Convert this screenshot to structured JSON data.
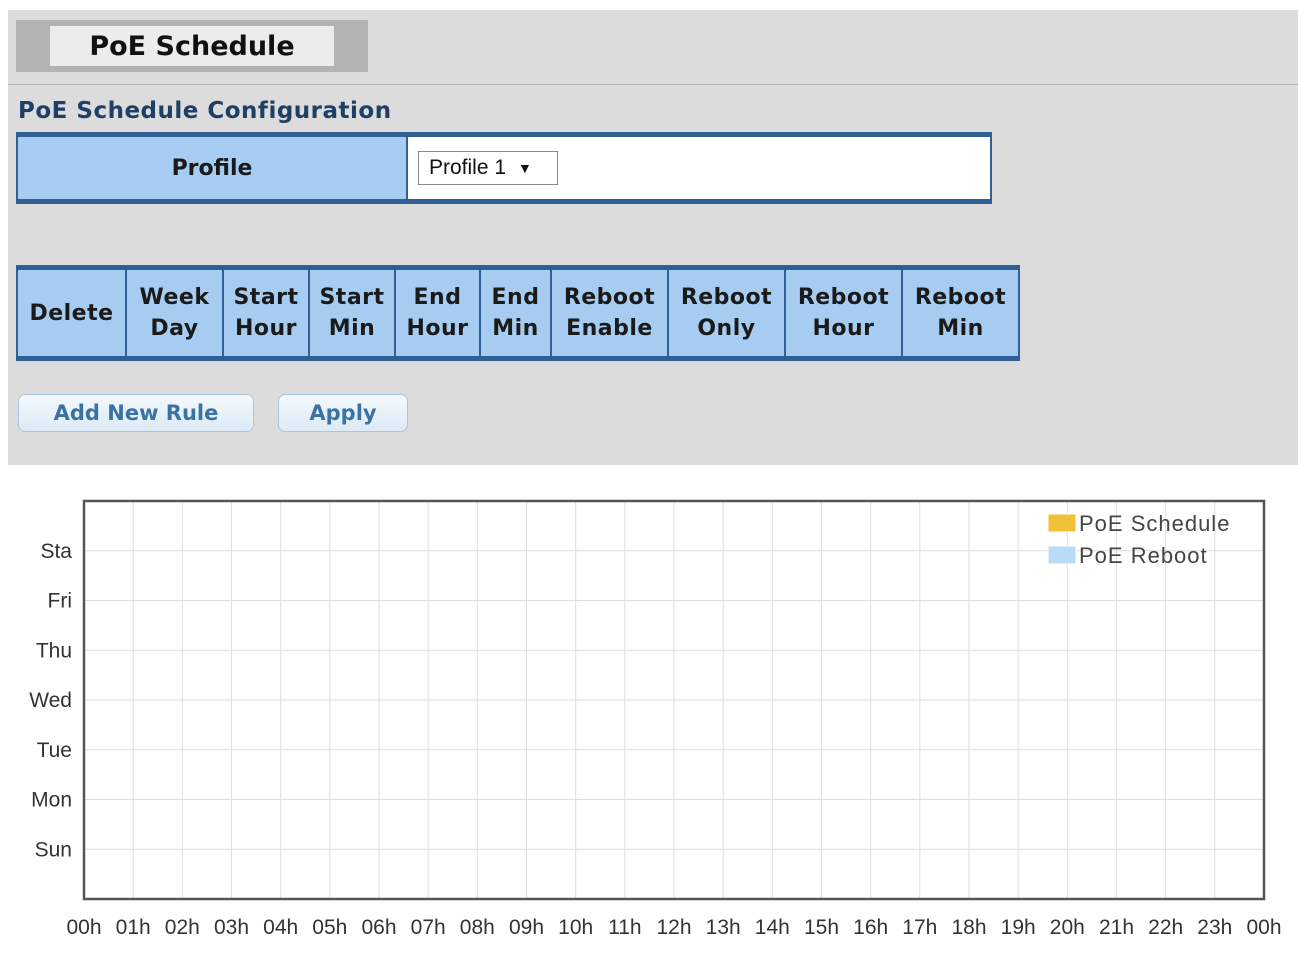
{
  "header": {
    "tab_title": "PoE Schedule",
    "section_title": "PoE Schedule Configuration"
  },
  "profile": {
    "label": "Profile",
    "selected": "Profile 1",
    "dropdown_icon": "triangle-down-icon"
  },
  "rules_table": {
    "columns": [
      {
        "line1": "Delete",
        "line2": ""
      },
      {
        "line1": "Week",
        "line2": "Day"
      },
      {
        "line1": "Start",
        "line2": "Hour"
      },
      {
        "line1": "Start",
        "line2": "Min"
      },
      {
        "line1": "End",
        "line2": "Hour"
      },
      {
        "line1": "End",
        "line2": "Min"
      },
      {
        "line1": "Reboot",
        "line2": "Enable"
      },
      {
        "line1": "Reboot",
        "line2": "Only"
      },
      {
        "line1": "Reboot",
        "line2": "Hour"
      },
      {
        "line1": "Reboot",
        "line2": "Min"
      }
    ],
    "rows": []
  },
  "buttons": {
    "add_new_rule": "Add New Rule",
    "apply": "Apply"
  },
  "colors": {
    "table_header_bg": "#a6cdf1",
    "table_border": "#2f5f93",
    "section_title": "#1f3f66",
    "legend_schedule": "#f2c038",
    "legend_reboot": "#b8dcf8"
  },
  "chart_data": {
    "type": "bar",
    "title": "",
    "xlabel": "",
    "ylabel": "",
    "x_ticks": [
      "00h",
      "01h",
      "02h",
      "03h",
      "04h",
      "05h",
      "06h",
      "07h",
      "08h",
      "09h",
      "10h",
      "11h",
      "12h",
      "13h",
      "14h",
      "15h",
      "16h",
      "17h",
      "18h",
      "19h",
      "20h",
      "21h",
      "22h",
      "23h",
      "00h"
    ],
    "y_categories": [
      "Sun",
      "Mon",
      "Tue",
      "Wed",
      "Thu",
      "Fri",
      "Sta"
    ],
    "xlim": [
      0,
      24
    ],
    "grid": true,
    "legend_position": "top-right",
    "series": [
      {
        "name": "PoE Schedule",
        "color": "#f2c038",
        "values": []
      },
      {
        "name": "PoE Reboot",
        "color": "#b8dcf8",
        "values": []
      }
    ]
  }
}
